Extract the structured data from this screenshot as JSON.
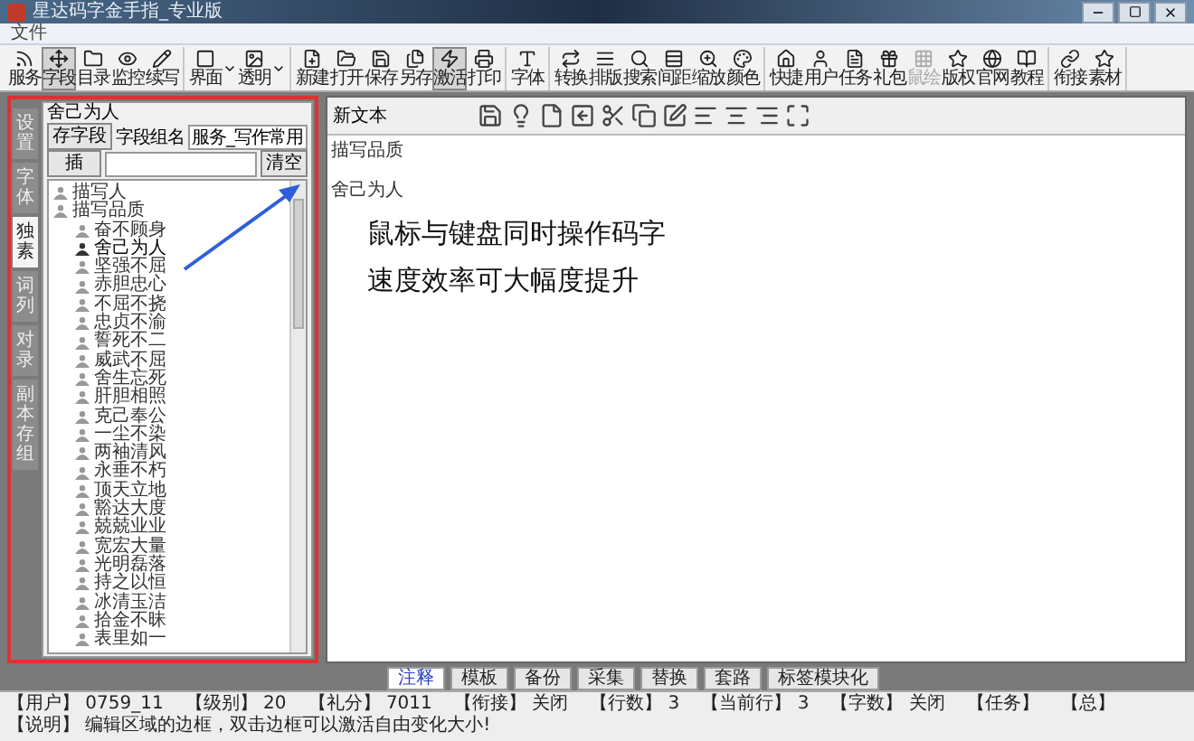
{
  "window": {
    "title": "星达码字金手指_专业版"
  },
  "menu": [
    "文件"
  ],
  "toolbar": {
    "groups": [
      {
        "buttons": [
          {
            "label": "服务",
            "selected": false,
            "disabled": false,
            "dropdown": false
          },
          {
            "label": "字段",
            "selected": true,
            "disabled": false,
            "dropdown": false
          },
          {
            "label": "目录",
            "selected": false,
            "disabled": false,
            "dropdown": false
          },
          {
            "label": "监控",
            "selected": false,
            "disabled": false,
            "dropdown": false
          },
          {
            "label": "续写",
            "selected": false,
            "disabled": false,
            "dropdown": false
          }
        ]
      },
      {
        "buttons": [
          {
            "label": "界面",
            "selected": false,
            "disabled": false,
            "dropdown": true
          },
          {
            "label": "透明",
            "selected": false,
            "disabled": false,
            "dropdown": true
          }
        ]
      },
      {
        "buttons": [
          {
            "label": "新建",
            "selected": false,
            "disabled": false,
            "dropdown": false
          },
          {
            "label": "打开",
            "selected": false,
            "disabled": false,
            "dropdown": false
          },
          {
            "label": "保存",
            "selected": false,
            "disabled": false,
            "dropdown": false
          },
          {
            "label": "另存",
            "selected": false,
            "disabled": false,
            "dropdown": false
          },
          {
            "label": "激活",
            "selected": true,
            "disabled": false,
            "dropdown": false
          },
          {
            "label": "打印",
            "selected": false,
            "disabled": false,
            "dropdown": false
          }
        ]
      },
      {
        "buttons": [
          {
            "label": "字体",
            "selected": false,
            "disabled": false,
            "dropdown": false
          }
        ]
      },
      {
        "buttons": [
          {
            "label": "转换",
            "selected": false,
            "disabled": false,
            "dropdown": false
          },
          {
            "label": "排版",
            "selected": false,
            "disabled": false,
            "dropdown": false
          },
          {
            "label": "搜索",
            "selected": false,
            "disabled": false,
            "dropdown": false
          },
          {
            "label": "间距",
            "selected": false,
            "disabled": false,
            "dropdown": false
          },
          {
            "label": "缩放",
            "selected": false,
            "disabled": false,
            "dropdown": false
          },
          {
            "label": "颜色",
            "selected": false,
            "disabled": false,
            "dropdown": false
          }
        ]
      },
      {
        "buttons": [
          {
            "label": "快捷",
            "selected": false,
            "disabled": false,
            "dropdown": false
          },
          {
            "label": "用户",
            "selected": false,
            "disabled": false,
            "dropdown": false
          },
          {
            "label": "任务",
            "selected": false,
            "disabled": false,
            "dropdown": false
          },
          {
            "label": "礼包",
            "selected": false,
            "disabled": false,
            "dropdown": false
          },
          {
            "label": "鼠绘",
            "selected": false,
            "disabled": true,
            "dropdown": false
          },
          {
            "label": "版权",
            "selected": false,
            "disabled": false,
            "dropdown": false
          },
          {
            "label": "官网",
            "selected": false,
            "disabled": false,
            "dropdown": false
          },
          {
            "label": "教程",
            "selected": false,
            "disabled": false,
            "dropdown": false
          }
        ]
      },
      {
        "buttons": [
          {
            "label": "衔接",
            "selected": false,
            "disabled": false,
            "dropdown": false
          },
          {
            "label": "素材",
            "selected": false,
            "disabled": false,
            "dropdown": false
          }
        ]
      }
    ]
  },
  "side_tabs": [
    {
      "label": "设置",
      "selected": false
    },
    {
      "label": "字体",
      "selected": false
    },
    {
      "label": "独素",
      "selected": true
    },
    {
      "label": "词列",
      "selected": false
    },
    {
      "label": "对录",
      "selected": false
    },
    {
      "label": "副本存组",
      "selected": false
    }
  ],
  "field_panel": {
    "title": "舍己为人",
    "save_button": "存字段",
    "group_label": "字段组名",
    "group_value": "服务_写作常用",
    "insert_button": "插",
    "clear_button": "清空",
    "tree": [
      {
        "label": "描写人",
        "selected": false
      },
      {
        "label": "描写品质",
        "selected": false,
        "expanded": true,
        "children": [
          {
            "label": "奋不顾身",
            "selected": false
          },
          {
            "label": "舍己为人",
            "selected": true
          },
          {
            "label": "坚强不屈",
            "selected": false
          },
          {
            "label": "赤胆忠心",
            "selected": false
          },
          {
            "label": "不屈不挠",
            "selected": false
          },
          {
            "label": "忠贞不渝",
            "selected": false
          },
          {
            "label": "誓死不二",
            "selected": false
          },
          {
            "label": "威武不屈",
            "selected": false
          },
          {
            "label": "舍生忘死",
            "selected": false
          },
          {
            "label": "肝胆相照",
            "selected": false
          },
          {
            "label": "克己奉公",
            "selected": false
          },
          {
            "label": "一尘不染",
            "selected": false
          },
          {
            "label": "两袖清风",
            "selected": false
          },
          {
            "label": "永垂不朽",
            "selected": false
          },
          {
            "label": "顶天立地",
            "selected": false
          },
          {
            "label": "豁达大度",
            "selected": false
          },
          {
            "label": "兢兢业业",
            "selected": false
          },
          {
            "label": "宽宏大量",
            "selected": false
          },
          {
            "label": "光明磊落",
            "selected": false
          },
          {
            "label": "持之以恒",
            "selected": false
          },
          {
            "label": "冰清玉洁",
            "selected": false
          },
          {
            "label": "拾金不昧",
            "selected": false
          },
          {
            "label": "表里如一",
            "selected": false
          }
        ]
      }
    ]
  },
  "editor": {
    "title": "新文本",
    "lines": [
      "描写品质",
      "舍己为人"
    ],
    "callout": [
      "鼠标与键盘同时操作码字",
      "速度效率可大幅度提升"
    ]
  },
  "bottom_tabs": [
    {
      "label": "注释",
      "selected": true
    },
    {
      "label": "模板",
      "selected": false
    },
    {
      "label": "备份",
      "selected": false
    },
    {
      "label": "采集",
      "selected": false
    },
    {
      "label": "替换",
      "selected": false
    },
    {
      "label": "套路",
      "selected": false
    },
    {
      "label": "标签模块化",
      "selected": false
    }
  ],
  "status_bar": [
    {
      "label": "【用户】",
      "value": "0759_11"
    },
    {
      "label": "【级别】",
      "value": "20"
    },
    {
      "label": "【礼分】",
      "value": "7011"
    },
    {
      "label": "【衔接】",
      "value": "关闭"
    },
    {
      "label": "【行数】",
      "value": "3"
    },
    {
      "label": "【当前行】",
      "value": "3"
    },
    {
      "label": "【字数】",
      "value": "关闭"
    },
    {
      "label": "【任务】"
    },
    {
      "label": "【总】"
    },
    {
      "label": "【说明】",
      "value": "编辑区域的边框，双击边框可以激活自由变化大小!"
    }
  ]
}
